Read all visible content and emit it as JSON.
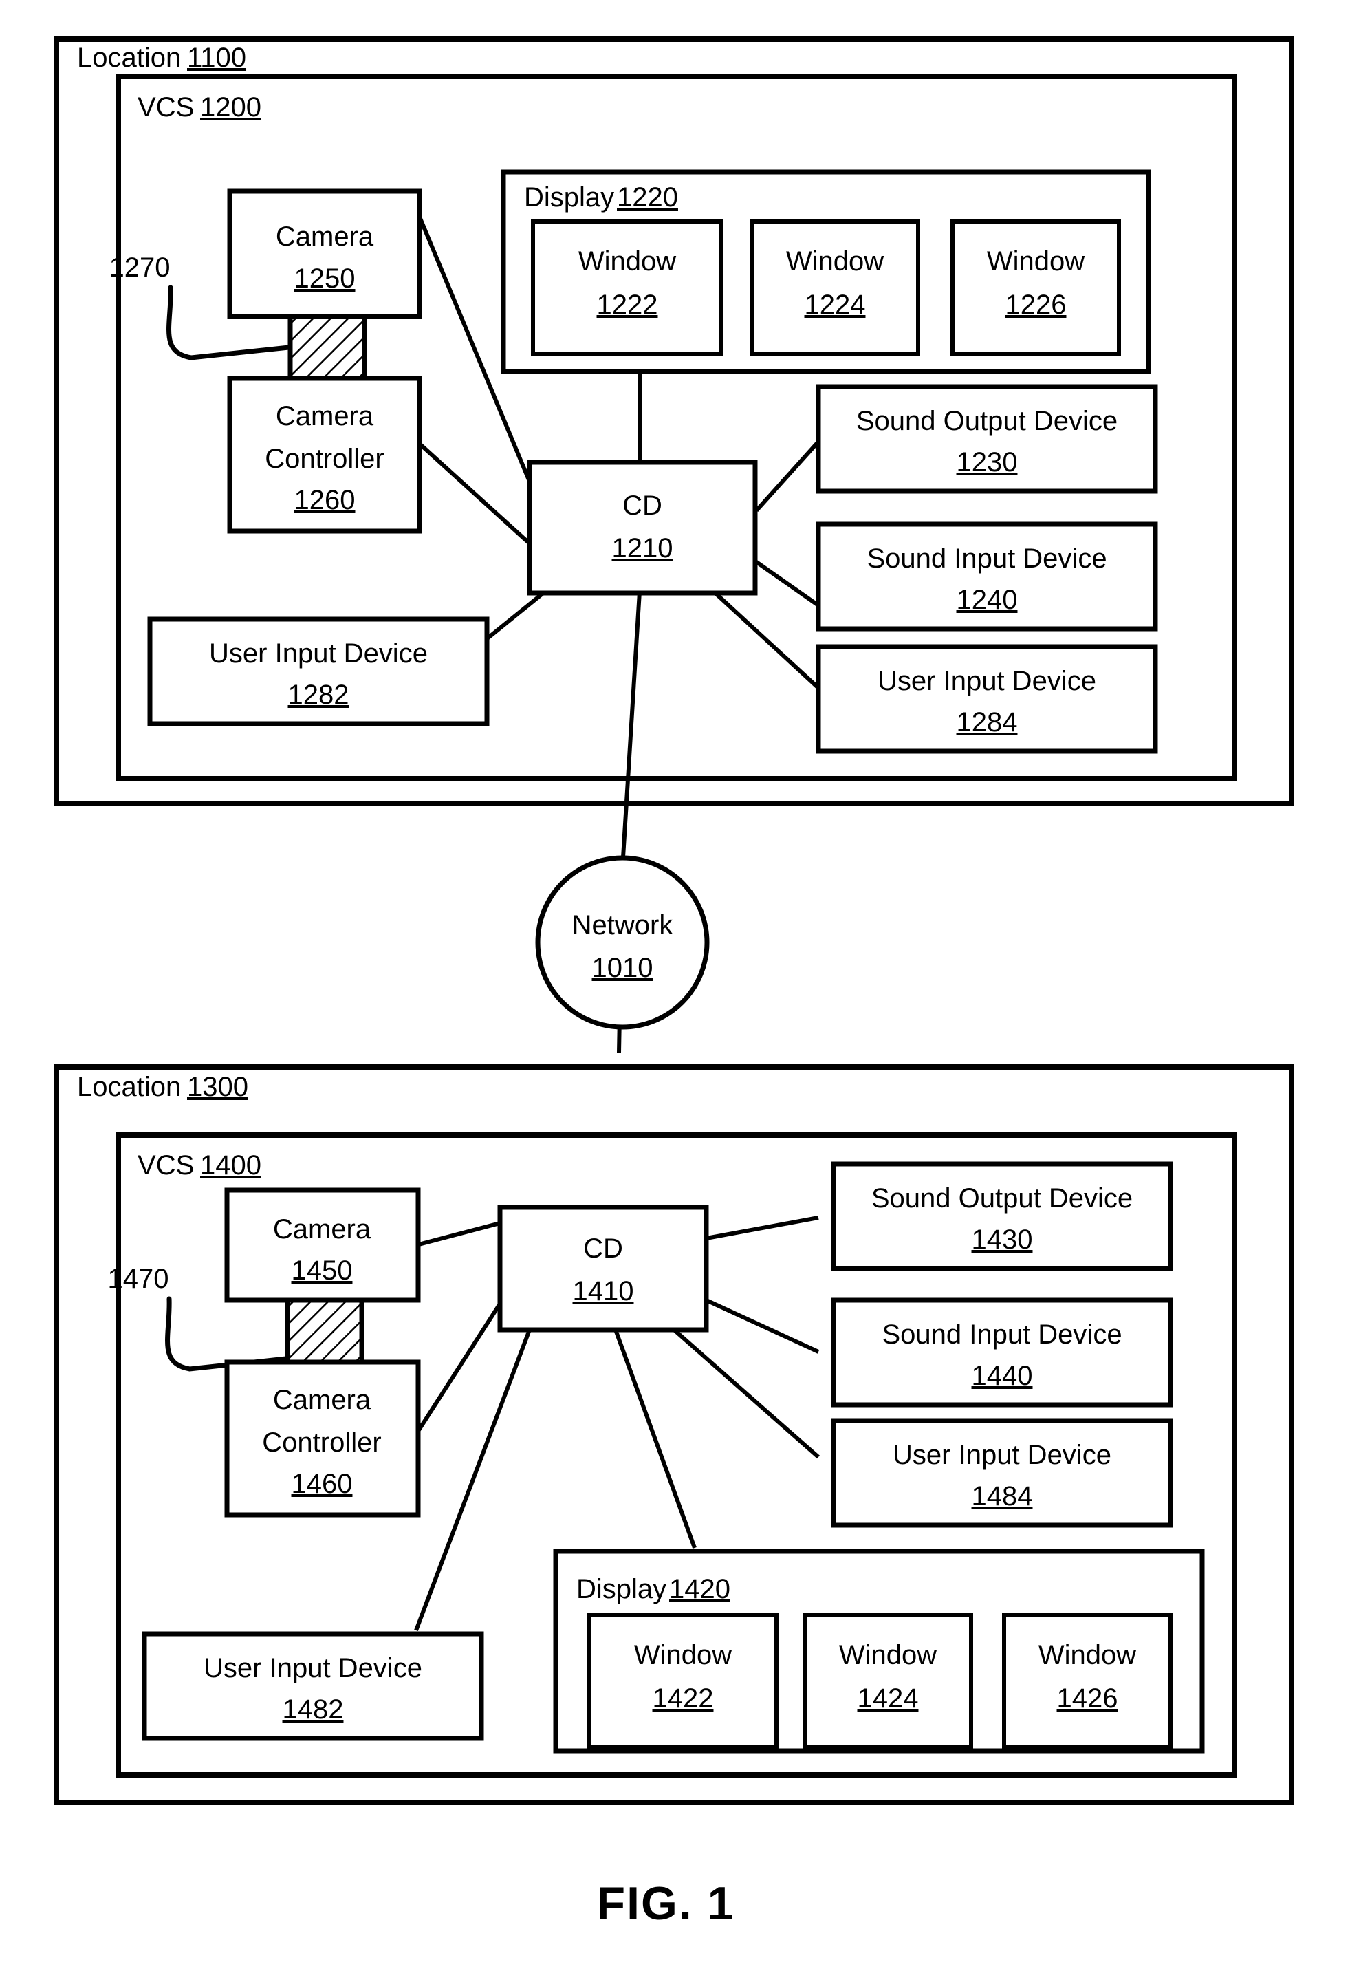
{
  "figure": {
    "caption": "FIG. 1",
    "title": "Videoconferencing system block diagram"
  },
  "network": {
    "label": "Network",
    "ref": "1010"
  },
  "locations": [
    {
      "id": "top",
      "label": "Location",
      "ref": "1100",
      "vcs": {
        "label": "VCS",
        "ref": "1200"
      },
      "camera": {
        "label": "Camera",
        "ref": "1250"
      },
      "camera_controller": {
        "line1": "Camera",
        "line2": "Controller",
        "ref": "1260"
      },
      "coupling_ref": "1270",
      "cd": {
        "label": "CD",
        "ref": "1210"
      },
      "display": {
        "label": "Display",
        "ref": "1220",
        "windows": [
          {
            "label": "Window",
            "ref": "1222"
          },
          {
            "label": "Window",
            "ref": "1224"
          },
          {
            "label": "Window",
            "ref": "1226"
          }
        ]
      },
      "devices": [
        {
          "label": "Sound Output Device",
          "ref": "1230"
        },
        {
          "label": "Sound Input Device",
          "ref": "1240"
        },
        {
          "label": "User Input Device",
          "ref": "1284"
        }
      ],
      "user_input_left": {
        "label": "User Input Device",
        "ref": "1282"
      }
    },
    {
      "id": "bottom",
      "label": "Location",
      "ref": "1300",
      "vcs": {
        "label": "VCS",
        "ref": "1400"
      },
      "camera": {
        "label": "Camera",
        "ref": "1450"
      },
      "camera_controller": {
        "line1": "Camera",
        "line2": "Controller",
        "ref": "1460"
      },
      "coupling_ref": "1470",
      "cd": {
        "label": "CD",
        "ref": "1410"
      },
      "display": {
        "label": "Display",
        "ref": "1420",
        "windows": [
          {
            "label": "Window",
            "ref": "1422"
          },
          {
            "label": "Window",
            "ref": "1424"
          },
          {
            "label": "Window",
            "ref": "1426"
          }
        ]
      },
      "devices": [
        {
          "label": "Sound Output Device",
          "ref": "1430"
        },
        {
          "label": "Sound Input Device",
          "ref": "1440"
        },
        {
          "label": "User Input Device",
          "ref": "1484"
        }
      ],
      "user_input_left": {
        "label": "User Input Device",
        "ref": "1482"
      }
    }
  ],
  "colors": {
    "stroke": "#000000",
    "background": "#ffffff"
  }
}
